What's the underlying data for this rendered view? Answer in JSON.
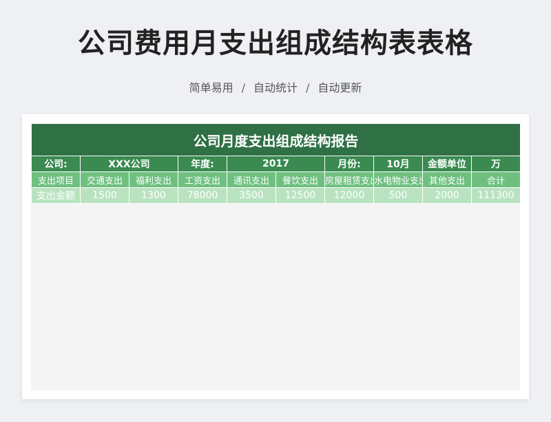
{
  "header": {
    "title": "公司费用月支出组成结构表表格",
    "tags": [
      "简单易用",
      "自动统计",
      "自动更新"
    ],
    "separator": "/"
  },
  "report": {
    "title": "公司月度支出组成结构报告",
    "meta": {
      "company_label": "公司:",
      "company_value": "XXX公司",
      "year_label": "年度:",
      "year_value": "2017",
      "month_label": "月份:",
      "month_value": "10月",
      "unit_label": "金额单位",
      "unit_value": "万"
    },
    "items_header": "支出项目",
    "items": [
      "交通支出",
      "福利支出",
      "工资支出",
      "通讯支出",
      "餐饮支出",
      "房屋租赁支出",
      "水电物业支出",
      "其他支出",
      "合计"
    ],
    "amounts_header": "支出金额",
    "amounts": [
      "1500",
      "1300",
      "78000",
      "3500",
      "12500",
      "12000",
      "500",
      "2000",
      "111300"
    ]
  },
  "colors": {
    "title_bar": "#2f7045",
    "meta_row": "#3a8a51",
    "items_row": "#6fc080",
    "amounts_row": "#b9e3c0",
    "page_bg": "#eef0f3"
  }
}
